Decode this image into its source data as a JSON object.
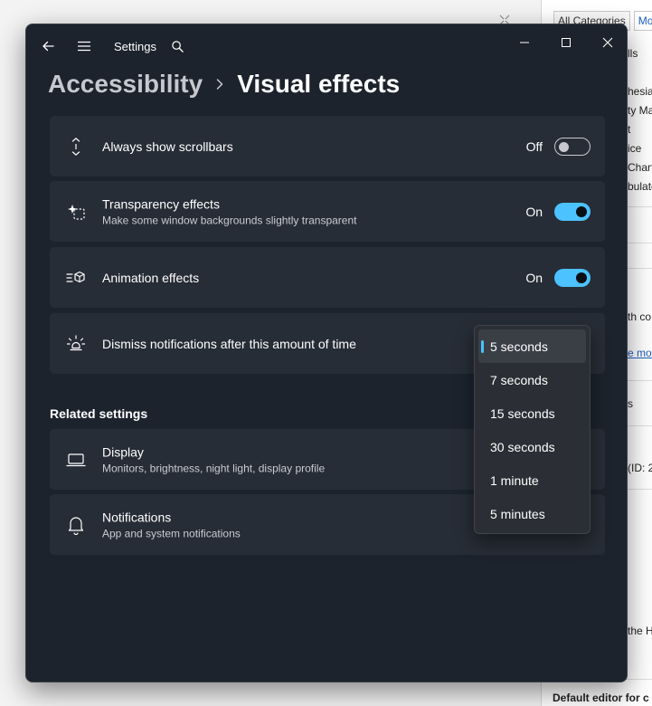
{
  "background": {
    "tabs": [
      "All Categories",
      "Mos"
    ],
    "fragments": [
      "lls",
      "hesia",
      "ty Ma",
      "t",
      "ice",
      "Chart",
      "bulate",
      "th co",
      "e mos",
      "s",
      "(ID: 2",
      "the H"
    ],
    "footer": "Default editor for c"
  },
  "titlebar": {
    "app_title": "Settings",
    "back_icon": "back-arrow-icon",
    "menu_icon": "hamburger-icon",
    "search_icon": "search-icon"
  },
  "breadcrumb": {
    "parent": "Accessibility",
    "current": "Visual effects"
  },
  "settings": [
    {
      "title": "Always show scrollbars",
      "subtitle": "",
      "state": "Off",
      "on": false,
      "icon": "scrollbar-arrows-icon"
    },
    {
      "title": "Transparency effects",
      "subtitle": "Make some window backgrounds slightly transparent",
      "state": "On",
      "on": true,
      "icon": "transparency-sparkle-icon"
    },
    {
      "title": "Animation effects",
      "subtitle": "",
      "state": "On",
      "on": true,
      "icon": "animation-cube-icon"
    },
    {
      "title": "Dismiss notifications after this amount of time",
      "subtitle": "",
      "icon": "notification-sun-icon"
    }
  ],
  "related": {
    "title": "Related settings",
    "items": [
      {
        "title": "Display",
        "subtitle": "Monitors, brightness, night light, display profile",
        "icon": "laptop-icon"
      },
      {
        "title": "Notifications",
        "subtitle": "App and system notifications",
        "icon": "bell-icon"
      }
    ]
  },
  "dropdown": {
    "selected": "5 seconds",
    "options": [
      "5 seconds",
      "7 seconds",
      "15 seconds",
      "30 seconds",
      "1 minute",
      "5 minutes"
    ]
  },
  "colors": {
    "accent": "#4cc2ff",
    "window_bg": "#1c232c",
    "card_bg": "#272d36"
  }
}
